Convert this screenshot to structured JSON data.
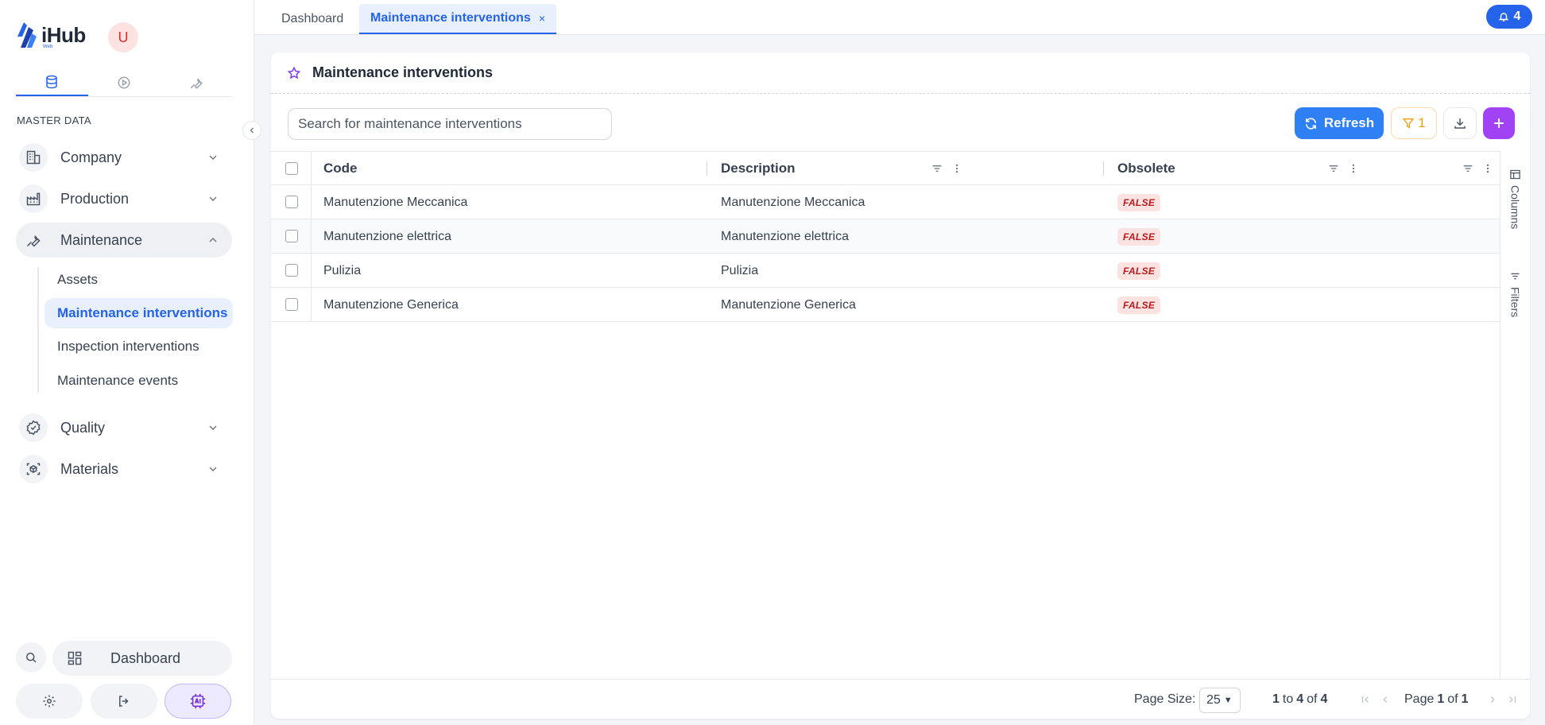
{
  "brand": {
    "name": "iHub",
    "sub": "Web"
  },
  "user": {
    "initial": "U"
  },
  "sidebar": {
    "section": "MASTER DATA",
    "groups": [
      {
        "label": "Company"
      },
      {
        "label": "Production"
      },
      {
        "label": "Maintenance"
      },
      {
        "label": "Quality"
      },
      {
        "label": "Materials"
      }
    ],
    "maintenance_items": [
      {
        "label": "Assets"
      },
      {
        "label": "Maintenance interventions"
      },
      {
        "label": "Inspection interventions"
      },
      {
        "label": "Maintenance events"
      }
    ],
    "bottom": {
      "dashboard_label": "Dashboard"
    }
  },
  "tabs": [
    {
      "label": "Dashboard"
    },
    {
      "label": "Maintenance interventions",
      "close": "×"
    }
  ],
  "notifications": {
    "count": "4"
  },
  "page": {
    "title": "Maintenance interventions",
    "search_placeholder": "Search for maintenance interventions",
    "refresh_label": "Refresh",
    "filter_count": "1"
  },
  "grid": {
    "columns": [
      "Code",
      "Description",
      "Obsolete"
    ],
    "rows": [
      {
        "code": "Manutenzione Meccanica",
        "description": "Manutenzione Meccanica",
        "obsolete": "FALSE"
      },
      {
        "code": "Manutenzione elettrica",
        "description": "Manutenzione elettrica",
        "obsolete": "FALSE"
      },
      {
        "code": "Pulizia",
        "description": "Pulizia",
        "obsolete": "FALSE"
      },
      {
        "code": "Manutenzione Generica",
        "description": "Manutenzione Generica",
        "obsolete": "FALSE"
      }
    ],
    "side_panel": {
      "columns_label": "Columns",
      "filters_label": "Filters"
    }
  },
  "pagination": {
    "page_size_label": "Page Size:",
    "page_size": "25",
    "range_from": "1",
    "range_to_word": "to",
    "range_to": "4",
    "range_of_word": "of",
    "range_total": "4",
    "page_word": "Page",
    "page_current": "1",
    "page_of_word": "of",
    "page_total": "1"
  },
  "colors": {
    "accent": "#2563eb",
    "refresh": "#2f7ff5",
    "add": "#a142f4",
    "filter": "#f59e0b",
    "badge_bg": "#fde2e2",
    "badge_text": "#b91c1c"
  }
}
